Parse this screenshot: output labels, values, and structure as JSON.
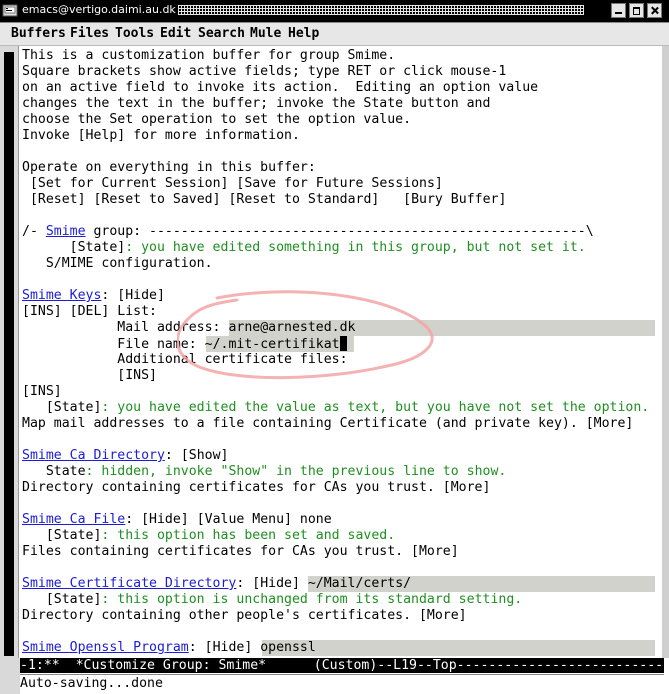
{
  "window": {
    "title": "emacs@vertigo.daimi.au.dk"
  },
  "menubar": {
    "items": [
      "Buffers",
      "Files",
      "Tools",
      "Edit",
      "Search",
      "Mule",
      "Help"
    ]
  },
  "intro": [
    "This is a customization buffer for group Smime.",
    "Square brackets show active fields; type RET or click mouse-1",
    "on an active field to invoke its action.  Editing an option value",
    "changes the text in the buffer; invoke the State button and",
    "choose the Set operation to set the option value.",
    "Invoke [Help] for more information."
  ],
  "operate": {
    "label": "Operate on everything in this buffer:",
    "set_session": "[Set for Current Session]",
    "save_future": "[Save for Future Sessions]",
    "reset": "[Reset]",
    "reset_saved": "[Reset to Saved]",
    "reset_standard": "[Reset to Standard]",
    "bury": "[Bury Buffer]"
  },
  "group": {
    "prefix": "/- ",
    "name": "Smime",
    "suffix": " group: -------------------------------------------------------\\",
    "state_button": "[State]",
    "state_text": ": you have edited something in this group, but not set it.",
    "doc": "S/MIME configuration."
  },
  "keys": {
    "name": "Smime Keys",
    "sep": ": ",
    "hide": "[Hide]",
    "ins": "[INS]",
    "del": "[DEL]",
    "list_label": " List:",
    "mail_label": "Mail address: ",
    "mail_value": "arne@arnested.dk",
    "file_label": "File name: ",
    "file_value": "~/.mit-certifikat",
    "additional_label": "Additional certificate files:",
    "inner_ins": "[INS]",
    "outer_ins": "[INS]",
    "state_button": "[State]",
    "state_text": ": you have edited the value as text, but you have not set the option.",
    "doc": "Map mail addresses to a file containing Certificate (and private key). ",
    "more": "[More]"
  },
  "ca_directory": {
    "name": "Smime Ca Directory",
    "show": "[Show]",
    "state_label": "State",
    "state_text": ": hidden, invoke \"Show\" in the previous line to show.",
    "doc": "Directory containing certificates for CAs you trust. ",
    "more": "[More]"
  },
  "ca_file": {
    "name": "Smime Ca File",
    "hide": "[Hide]",
    "value_menu": "[Value Menu]",
    "value": " none",
    "state_button": "[State]",
    "state_text": ": this option has been set and saved.",
    "doc": "Files containing certificates for CAs you trust. ",
    "more": "[More]"
  },
  "cert_directory": {
    "name": "Smime Certificate Directory",
    "hide": "[Hide]",
    "value": "~/Mail/certs/",
    "state_button": "[State]",
    "state_text": ": this option is unchanged from its standard setting.",
    "doc": "Directory containing other people's certificates. ",
    "more": "[More]"
  },
  "openssl": {
    "name": "Smime Openssl Program",
    "hide": "[Hide]",
    "value": "openssl"
  },
  "modeline": "-1:**  *Customize Group: Smime*      (Custom)--L19--Top----------------------------------------",
  "echo": "Auto-saving...done",
  "colors": {
    "link": "#1c1cd6",
    "state": "#1f8f20",
    "field_bg": "#d2d2cd",
    "annotation": "#f3a5a5"
  },
  "icons": {
    "title": "emacs-icon",
    "minimize": "minimize-icon",
    "maximize": "maximize-icon",
    "close": "close-icon"
  }
}
